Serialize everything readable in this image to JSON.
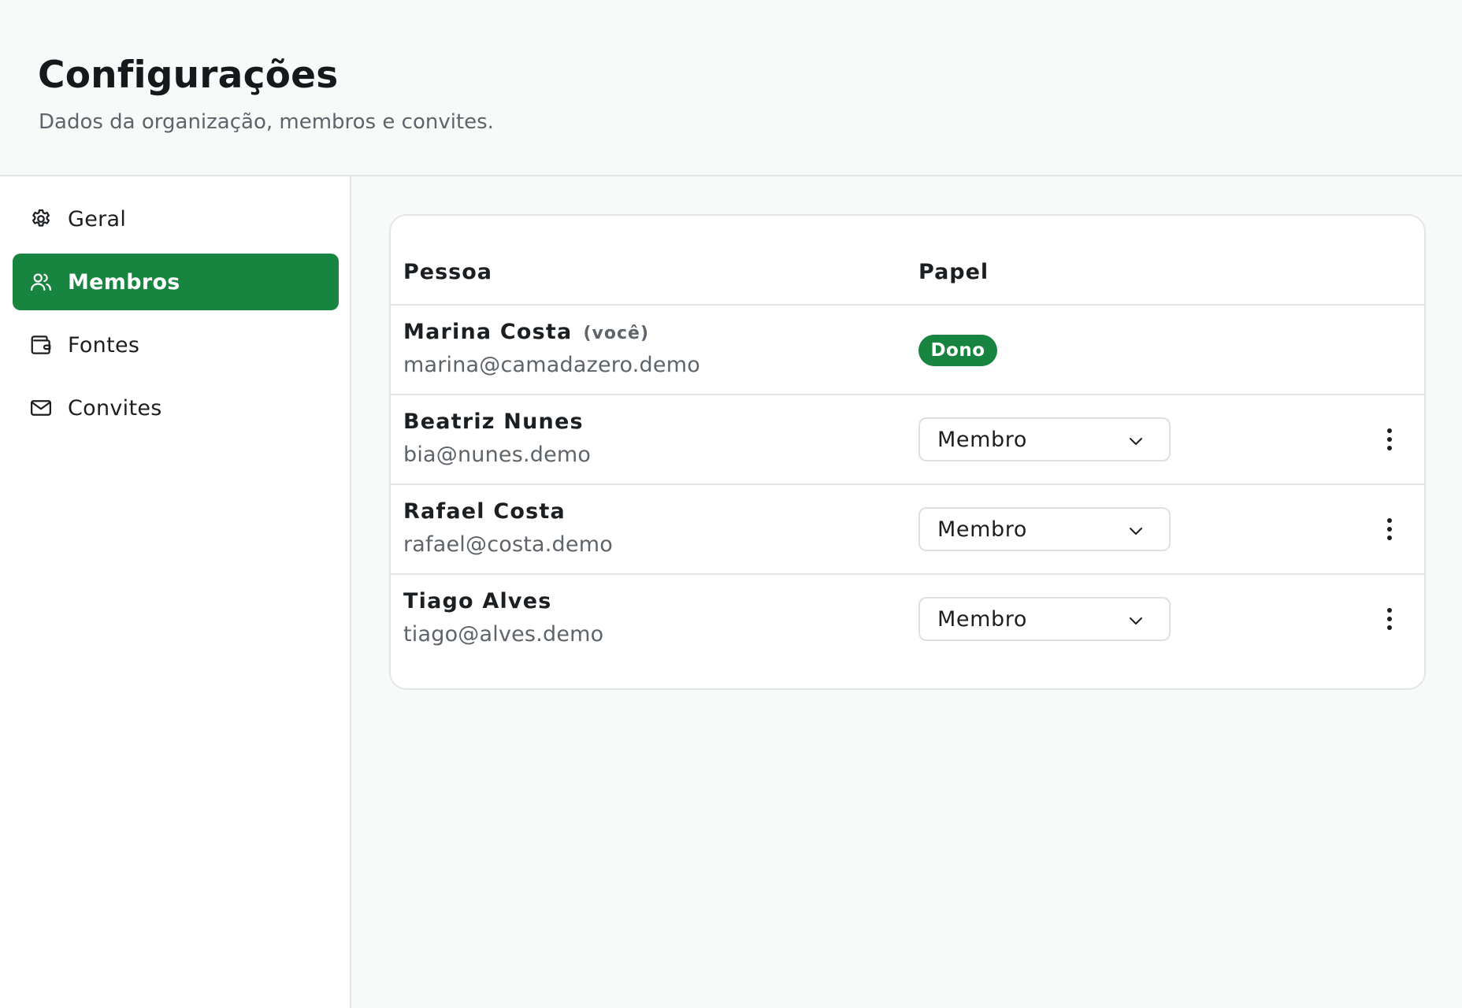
{
  "header": {
    "title": "Configurações",
    "subtitle": "Dados da organização, membros e convites."
  },
  "sidebar": {
    "items": [
      {
        "label": "Geral",
        "icon": "gear-icon",
        "active": false
      },
      {
        "label": "Membros",
        "icon": "users-icon",
        "active": true
      },
      {
        "label": "Fontes",
        "icon": "wallet-icon",
        "active": false
      },
      {
        "label": "Convites",
        "icon": "mail-icon",
        "active": false
      }
    ]
  },
  "members": {
    "columns": {
      "person": "Pessoa",
      "role": "Papel"
    },
    "rows": [
      {
        "name": "Marina Costa",
        "you_tag": "(você)",
        "email": "marina@camadazero.demo",
        "role": "Dono"
      },
      {
        "name": "Beatriz Nunes",
        "email": "bia@nunes.demo",
        "role": "Membro"
      },
      {
        "name": "Rafael Costa",
        "email": "rafael@costa.demo",
        "role": "Membro"
      },
      {
        "name": "Tiago Alves",
        "email": "tiago@alves.demo",
        "role": "Membro"
      }
    ]
  },
  "colors": {
    "accent": "#17843f",
    "background": "#f8f9f9",
    "border": "#e3e6e8",
    "muted_text": "#5e6469"
  }
}
